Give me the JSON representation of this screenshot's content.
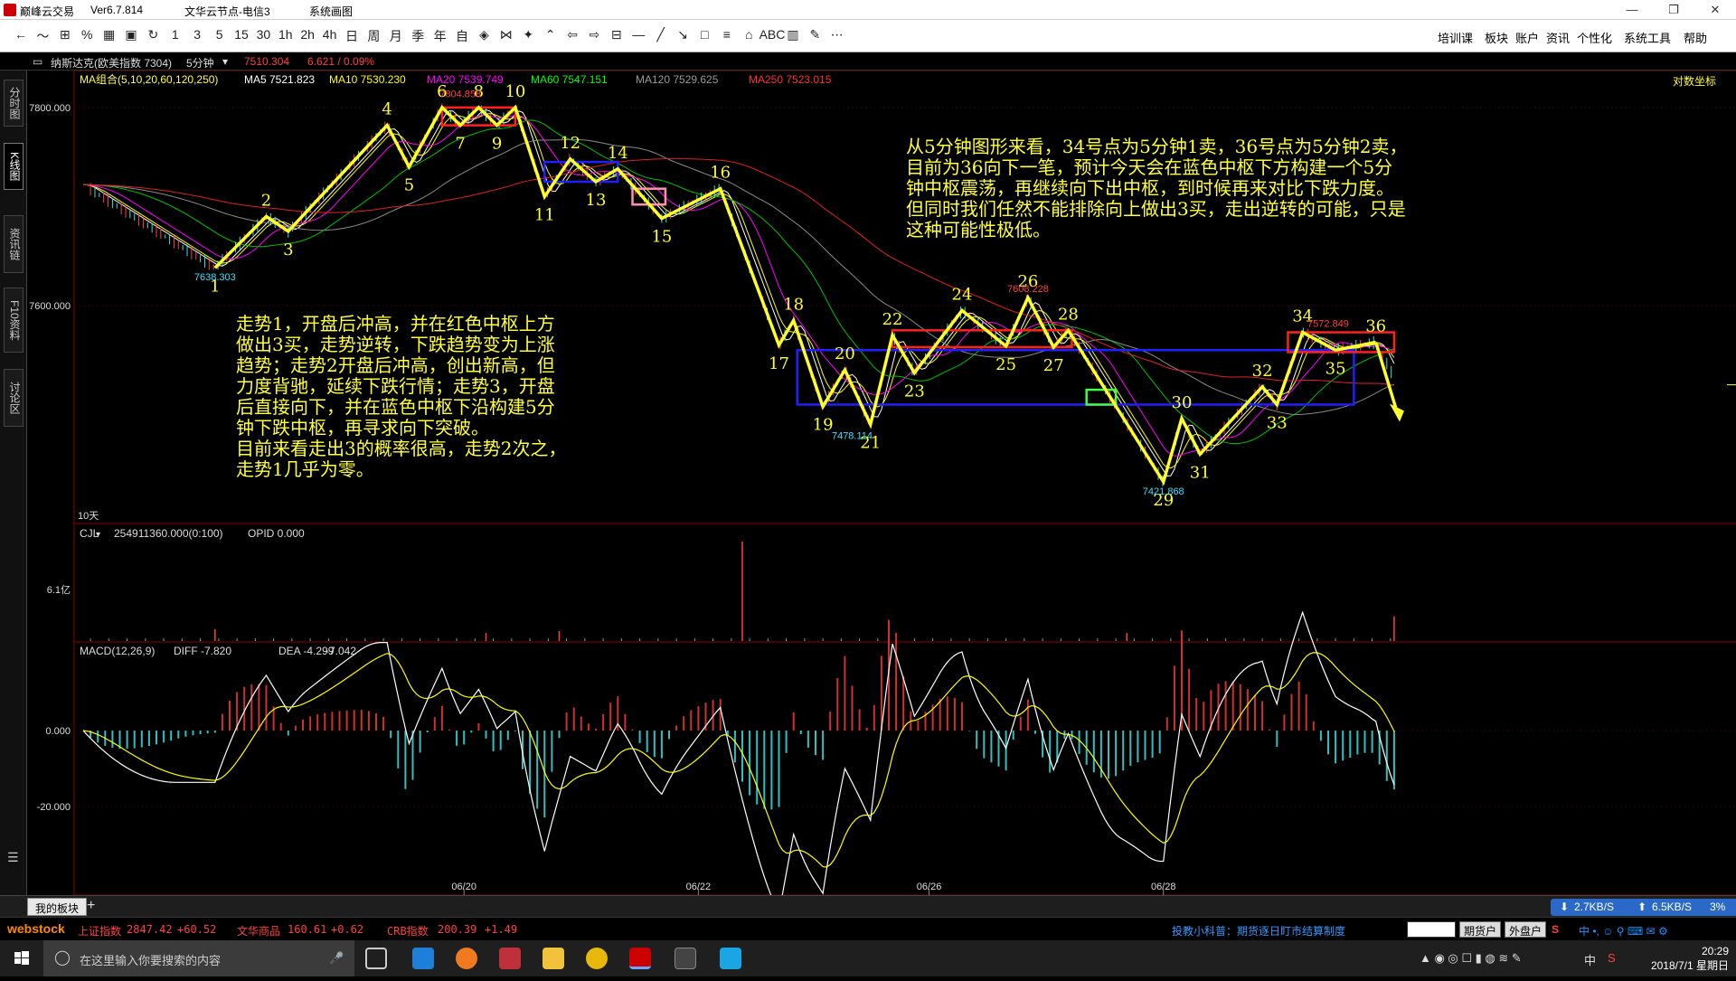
{
  "window": {
    "app_title": "巅峰云交易",
    "version": "Ver6.7.814",
    "server": "文华云节点-电信3",
    "module": "系统画图"
  },
  "toolbar": {
    "left_items": [
      "←",
      "〜",
      "⊞",
      "%",
      "▦",
      "▣",
      "↻",
      "1",
      "3",
      "5",
      "15",
      "30",
      "1h",
      "2h",
      "4h",
      "日",
      "周",
      "月",
      "季",
      "年",
      "自",
      "◈",
      "⋈",
      "✦",
      "⌃",
      "⇦",
      "⇨",
      "⊟",
      "—",
      "╱",
      "↘",
      "□",
      "≡",
      "⌂",
      "ABC",
      "▥",
      "✎",
      "⋯"
    ],
    "right_items": [
      "培训课",
      "板块",
      "账户",
      "资讯",
      "个性化",
      "系统工具",
      "帮助"
    ]
  },
  "instrument": {
    "name": "纳斯达克(欧美指数 7304)",
    "period": "5分钟",
    "price": "7510.304",
    "change": "6.621 / 0.09%"
  },
  "left_tabs": [
    "分时图",
    "K线图",
    "资讯链",
    "F10资料",
    "讨论区"
  ],
  "ma_legend": {
    "label": "MA组合(5,10,20,60,120,250)",
    "items": [
      {
        "text": "MA5 7521.823",
        "color": "#ffffff"
      },
      {
        "text": "MA10 7530.230",
        "color": "#ffff00"
      },
      {
        "text": "MA20 7539.749",
        "color": "#ff00ff"
      },
      {
        "text": "MA60 7547.151",
        "color": "#00ff00"
      },
      {
        "text": "MA120 7529.625",
        "color": "#9a9a9a"
      },
      {
        "text": "MA250 7523.015",
        "color": "#ff3030"
      }
    ],
    "log_label": "对数坐标"
  },
  "volume_legend": {
    "label": "CJL",
    "value": "254911360.000(0:100)",
    "opid": "OPID 0.000",
    "axis_tick": "6.1亿"
  },
  "macd_legend": {
    "label": "MACD(12,26,9)",
    "diff": "DIFF -7.820",
    "dea": "DEA -4.299",
    "macd": "-7.042"
  },
  "chart_data": {
    "type": "candlestick-with-annotations",
    "y_ticks_price": [
      "7800.000",
      "7600.000"
    ],
    "y_ticks_macd": [
      "0.000",
      "-20.000"
    ],
    "x_ticks": [
      "06/20",
      "06/22",
      "06/26",
      "06/28"
    ],
    "period_label": "10天",
    "price_labels": [
      {
        "text": "7804.858",
        "x": 10.3,
        "y": 7804.858,
        "color": "#ff4040"
      },
      {
        "text": "7638.303",
        "x": 3.6,
        "y": 7638.303,
        "color": "#40e0ff"
      },
      {
        "text": "7608.228",
        "x": 25.8,
        "y": 7608.228,
        "color": "#ff4040"
      },
      {
        "text": "7478.114",
        "x": 21.0,
        "y": 7478.114,
        "color": "#40e0ff"
      },
      {
        "text": "7572.849",
        "x": 34.0,
        "y": 7572.849,
        "color": "#ff4040"
      },
      {
        "text": "7421.868",
        "x": 29.5,
        "y": 7421.868,
        "color": "#40e0ff"
      }
    ],
    "wave_points": [
      {
        "label": "1",
        "x": 3.6,
        "y": 7638
      },
      {
        "label": "2",
        "x": 5.0,
        "y": 7690
      },
      {
        "label": "3",
        "x": 5.6,
        "y": 7675
      },
      {
        "label": "4",
        "x": 8.3,
        "y": 7782
      },
      {
        "label": "5",
        "x": 8.9,
        "y": 7740
      },
      {
        "label": "6",
        "x": 9.8,
        "y": 7800
      },
      {
        "label": "7",
        "x": 10.3,
        "y": 7782
      },
      {
        "label": "8",
        "x": 10.8,
        "y": 7800
      },
      {
        "label": "9",
        "x": 11.3,
        "y": 7782
      },
      {
        "label": "10",
        "x": 11.8,
        "y": 7800
      },
      {
        "label": "11",
        "x": 12.6,
        "y": 7710
      },
      {
        "label": "12",
        "x": 13.3,
        "y": 7748
      },
      {
        "label": "13",
        "x": 14.0,
        "y": 7725
      },
      {
        "label": "14",
        "x": 14.6,
        "y": 7738
      },
      {
        "label": "15",
        "x": 15.8,
        "y": 7688
      },
      {
        "label": "16",
        "x": 17.4,
        "y": 7718
      },
      {
        "label": "17",
        "x": 19.0,
        "y": 7560
      },
      {
        "label": "18",
        "x": 19.4,
        "y": 7585
      },
      {
        "label": "19",
        "x": 20.2,
        "y": 7498
      },
      {
        "label": "20",
        "x": 20.8,
        "y": 7535
      },
      {
        "label": "21",
        "x": 21.5,
        "y": 7480
      },
      {
        "label": "22",
        "x": 22.1,
        "y": 7570
      },
      {
        "label": "23",
        "x": 22.7,
        "y": 7532
      },
      {
        "label": "24",
        "x": 24.0,
        "y": 7595
      },
      {
        "label": "25",
        "x": 25.2,
        "y": 7559
      },
      {
        "label": "26",
        "x": 25.8,
        "y": 7608
      },
      {
        "label": "27",
        "x": 26.5,
        "y": 7558
      },
      {
        "label": "28",
        "x": 26.9,
        "y": 7575
      },
      {
        "label": "29",
        "x": 29.5,
        "y": 7422
      },
      {
        "label": "30",
        "x": 30.0,
        "y": 7486
      },
      {
        "label": "31",
        "x": 30.5,
        "y": 7450
      },
      {
        "label": "32",
        "x": 32.2,
        "y": 7518
      },
      {
        "label": "33",
        "x": 32.6,
        "y": 7500
      },
      {
        "label": "34",
        "x": 33.3,
        "y": 7573
      },
      {
        "label": "35",
        "x": 34.2,
        "y": 7555
      },
      {
        "label": "36",
        "x": 35.3,
        "y": 7563
      }
    ],
    "pivot_zones": [
      {
        "name": "red-pivot-top",
        "x1": 9.8,
        "x2": 11.8,
        "y1": 7782,
        "y2": 7800,
        "color": "#ff2020"
      },
      {
        "name": "blue-pivot-top",
        "x1": 12.6,
        "x2": 14.6,
        "y1": 7725,
        "y2": 7745,
        "color": "#2020ff"
      },
      {
        "name": "pink-box",
        "x1": 15.0,
        "x2": 15.9,
        "y1": 7702,
        "y2": 7718,
        "color": "#ff90b0"
      },
      {
        "name": "red-pivot-mid",
        "x1": 22.1,
        "x2": 27.0,
        "y1": 7558,
        "y2": 7575,
        "color": "#ff2020"
      },
      {
        "name": "blue-pivot-main",
        "x1": 19.5,
        "x2": 34.7,
        "y1": 7500,
        "y2": 7555,
        "color": "#2020ff"
      },
      {
        "name": "green-box",
        "x1": 27.4,
        "x2": 28.2,
        "y1": 7500,
        "y2": 7515,
        "color": "#40ff40"
      },
      {
        "name": "red-pivot-right",
        "x1": 32.9,
        "x2": 35.8,
        "y1": 7553,
        "y2": 7573,
        "color": "#ff2020"
      }
    ],
    "volume_spikes": [
      {
        "x": 3.6,
        "v": 0.12
      },
      {
        "x": 11.0,
        "v": 0.08
      },
      {
        "x": 13.0,
        "v": 0.1
      },
      {
        "x": 18.0,
        "v": 1.0
      },
      {
        "x": 22.0,
        "v": 0.1
      },
      {
        "x": 28.5,
        "v": 0.08
      },
      {
        "x": 30.0,
        "v": 0.06
      },
      {
        "x": 35.8,
        "v": 0.25
      }
    ]
  },
  "annotations": {
    "top_right": "从5分钟图形来看，34号点为5分钟1卖，36号点为5分钟2卖，\n目前为36向下一笔，预计今天会在蓝色中枢下方构建一个5分\n钟中枢震荡，再继续向下出中枢，到时候再来对比下跌力度。\n但同时我们任然不能排除向上做出3买，走出逆转的可能，只是\n这种可能性极低。",
    "left": "走势1，开盘后冲高，并在红色中枢上方\n做出3买，走势逆转，下跌趋势变为上涨\n趋势；走势2开盘后冲高，创出新高，但\n力度背驰，延续下跌行情；走势3，开盘\n后直接向下，并在蓝色中枢下沿构建5分\n钟下跌中枢，再寻求向下突破。\n目前来看走出3的概率很高，走势2次之，\n走势1几乎为零。"
  },
  "bottom_bar": {
    "tab": "我的板块",
    "net_down": "2.7KB/S",
    "net_up": "6.5KB/S",
    "net_pct": "3%"
  },
  "ticker": {
    "logo": "webstock",
    "items": [
      {
        "name": "上证指数",
        "value": "2847.42",
        "change": "+60.52"
      },
      {
        "name": "文华商品",
        "value": "160.61",
        "change": "+0.62"
      },
      {
        "name": "CRB指数",
        "value": "200.39",
        "change": "+1.49"
      }
    ],
    "tip": "投教小科普：期货逐日盯市结算制度",
    "btn_futures": "期货户",
    "btn_fx": "外盘户"
  },
  "taskbar": {
    "search_placeholder": "在这里输入你要搜索的内容",
    "time": "20:29",
    "date": "2018/7/1 星期日",
    "ime": "中"
  }
}
